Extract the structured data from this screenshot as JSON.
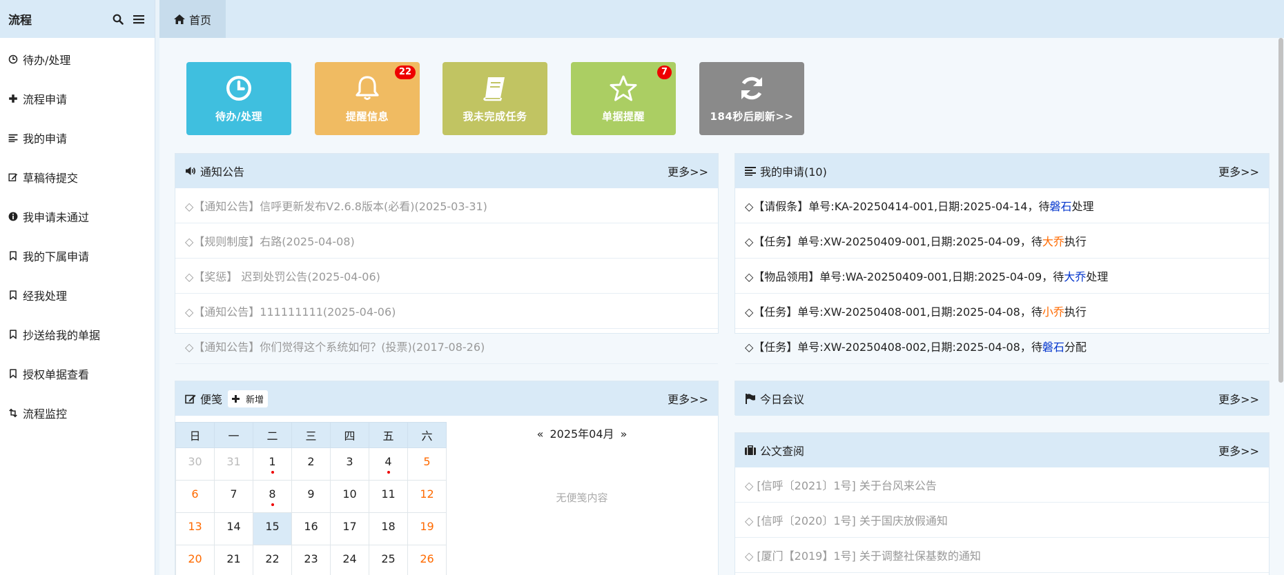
{
  "sidebar": {
    "title": "流程",
    "items": [
      {
        "label": "待办/处理",
        "icon": "clock-icon"
      },
      {
        "label": "流程申请",
        "icon": "plus-icon"
      },
      {
        "label": "我的申请",
        "icon": "list-icon"
      },
      {
        "label": "草稿待提交",
        "icon": "edit-icon"
      },
      {
        "label": "我申请未通过",
        "icon": "info-icon"
      },
      {
        "label": "我的下属申请",
        "icon": "bookmark-icon"
      },
      {
        "label": "经我处理",
        "icon": "bookmark-icon"
      },
      {
        "label": "抄送给我的单据",
        "icon": "bookmark-icon"
      },
      {
        "label": "授权单据查看",
        "icon": "bookmark-icon"
      },
      {
        "label": "流程监控",
        "icon": "retweet-icon"
      }
    ]
  },
  "topbar": {
    "home_tab": "首页"
  },
  "tiles": [
    {
      "label": "待办/处理",
      "icon": "clock-icon",
      "color": "#3fbfdf",
      "badge": ""
    },
    {
      "label": "提醒信息",
      "icon": "bell-icon",
      "color": "#f0bb62",
      "badge": "22"
    },
    {
      "label": "我未完成任务",
      "icon": "book-icon",
      "color": "#c1c462",
      "badge": ""
    },
    {
      "label": "单据提醒",
      "icon": "star-icon",
      "color": "#abce63",
      "badge": "7"
    },
    {
      "label": "184秒后刷新>>",
      "icon": "refresh-icon",
      "color": "#8a8a8a",
      "badge": ""
    }
  ],
  "notice": {
    "title": "通知公告",
    "more": "更多>>",
    "items": [
      "◇【通知公告】信呼更新发布V2.6.8版本(必看)(2025-03-31)",
      "◇【规则制度】右路(2025-04-08)",
      "◇【奖惩】 迟到处罚公告(2025-04-06)",
      "◇【通知公告】111111111(2025-04-06)",
      "◇【通知公告】你们觉得这个系统如何？(投票)(2017-08-26)"
    ]
  },
  "myapply": {
    "title": "我的申请(10)",
    "more": "更多>>",
    "items": [
      {
        "pre": "◇【请假条】单号:KA-20250414-001,日期:2025-04-14，待",
        "who": "磐石",
        "who_color": "blue",
        "post": "处理"
      },
      {
        "pre": "◇【任务】单号:XW-20250409-001,日期:2025-04-09，待",
        "who": "大乔",
        "who_color": "orange",
        "post": "执行"
      },
      {
        "pre": "◇【物品领用】单号:WA-20250409-001,日期:2025-04-09，待",
        "who": "大乔",
        "who_color": "blue",
        "post": "处理"
      },
      {
        "pre": "◇【任务】单号:XW-20250408-001,日期:2025-04-08，待",
        "who": "小乔",
        "who_color": "orange",
        "post": "执行"
      },
      {
        "pre": "◇【任务】单号:XW-20250408-002,日期:2025-04-08，待",
        "who": "磐石",
        "who_color": "blue",
        "post": "分配"
      }
    ]
  },
  "memo": {
    "title": "便笺",
    "add": "新增",
    "more": "更多>>",
    "month_label": "2025年04月",
    "prev": "«",
    "next": "»",
    "empty": "无便笺内容",
    "weekdays": [
      "日",
      "一",
      "二",
      "三",
      "四",
      "五",
      "六"
    ],
    "weeks": [
      [
        {
          "d": "30",
          "t": "other"
        },
        {
          "d": "31",
          "t": "other"
        },
        {
          "d": "1",
          "dot": true
        },
        {
          "d": "2"
        },
        {
          "d": "3"
        },
        {
          "d": "4",
          "dot": true
        },
        {
          "d": "5",
          "t": "weekend"
        }
      ],
      [
        {
          "d": "6",
          "t": "weekend"
        },
        {
          "d": "7"
        },
        {
          "d": "8",
          "dot": true
        },
        {
          "d": "9"
        },
        {
          "d": "10"
        },
        {
          "d": "11"
        },
        {
          "d": "12",
          "t": "weekend"
        }
      ],
      [
        {
          "d": "13",
          "t": "weekend"
        },
        {
          "d": "14"
        },
        {
          "d": "15",
          "today": true
        },
        {
          "d": "16"
        },
        {
          "d": "17"
        },
        {
          "d": "18"
        },
        {
          "d": "19",
          "t": "weekend"
        }
      ],
      [
        {
          "d": "20",
          "t": "weekend"
        },
        {
          "d": "21"
        },
        {
          "d": "22"
        },
        {
          "d": "23"
        },
        {
          "d": "24"
        },
        {
          "d": "25"
        },
        {
          "d": "26",
          "t": "weekend"
        }
      ]
    ]
  },
  "meeting": {
    "title": "今日会议",
    "more": "更多>>"
  },
  "docs": {
    "title": "公文查阅",
    "more": "更多>>",
    "items": [
      "◇ [信呼〔2021〕1号] 关于台风来公告",
      "◇ [信呼〔2020〕1号] 关于国庆放假通知",
      "◇ [厦门【2019】1号] 关于调整社保基数的通知"
    ]
  }
}
